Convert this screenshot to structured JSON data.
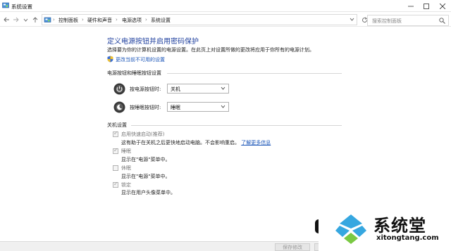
{
  "window": {
    "title": "系统设置"
  },
  "breadcrumb": [
    "控制面板",
    "硬件和声音",
    "电源选项",
    "系统设置"
  ],
  "search": {
    "placeholder": "搜索控制面板"
  },
  "page": {
    "heading": "定义电源按钮并启用密码保护",
    "description": "选择要为你的计算机设置的电源设置。在此页上对设置所做的更改将应用于你所有的电源计划。",
    "change_link": "更改当前不可用的设置"
  },
  "power_section": {
    "title": "电源按钮和睡眠按钮设置",
    "power_button": {
      "label": "按电源按钮时:",
      "value": "关机"
    },
    "sleep_button": {
      "label": "按睡眠按钮时:",
      "value": "睡眠"
    }
  },
  "shutdown_section": {
    "title": "关机设置",
    "items": [
      {
        "label": "启用快速启动(推荐)",
        "desc": "这有助于在关机之后更快地启动电脑。不会影响重启。",
        "link": "了解更多信息",
        "checked": true
      },
      {
        "label": "睡眠",
        "desc": "显示在\"电源\"菜单中。",
        "checked": true
      },
      {
        "label": "休眠",
        "desc": "显示在\"电源\"菜单中。",
        "checked": false
      },
      {
        "label": "锁定",
        "desc": "显示在用户头像菜单中。",
        "checked": true
      }
    ]
  },
  "footer": {
    "save_label": "保存修改"
  },
  "watermark": {
    "brand": "系统堂",
    "site": "xitongtang.com"
  },
  "colors": {
    "heading": "#1e3f9e",
    "link": "#1a55b8"
  }
}
